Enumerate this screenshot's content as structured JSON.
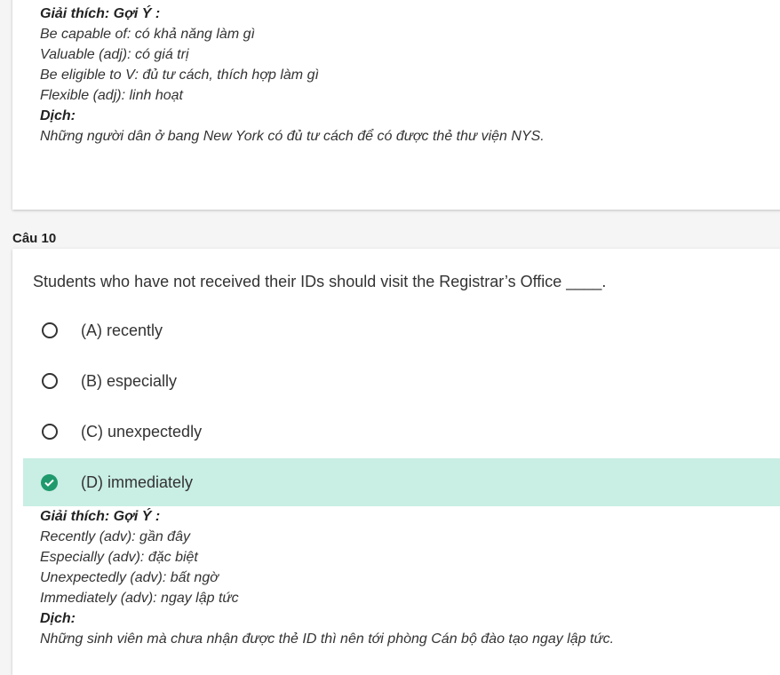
{
  "prev_explanation": {
    "heading": "Giải thích: Gợi Ý :",
    "lines": [
      "Be capable of: có khả năng làm gì",
      "Valuable (adj): có giá trị",
      "Be eligible to V: đủ tư cách, thích hợp làm gì",
      "Flexible (adj): linh hoạt"
    ],
    "translation_heading": "Dịch:",
    "translation": "Những người dân ở bang New York có đủ tư cách để có được thẻ thư viện NYS."
  },
  "question": {
    "label": "Câu 10",
    "text": "Students who have not received their IDs should visit the Registrar’s Office ____.",
    "options": [
      {
        "label": "(A) recently",
        "selected": false
      },
      {
        "label": "(B) especially",
        "selected": false
      },
      {
        "label": "(C) unexpectedly",
        "selected": false
      },
      {
        "label": "(D) immediately",
        "selected": true
      }
    ],
    "explanation": {
      "heading": "Giải thích: Gợi Ý :",
      "lines": [
        "Recently (adv): gần đây",
        "Especially (adv): đặc biệt",
        "Unexpectedly (adv): bất ngờ",
        "Immediately (adv): ngay lập tức"
      ],
      "translation_heading": "Dịch:",
      "translation": "Những sinh viên mà chưa nhận được thẻ ID thì nên tới phòng Cán bộ đào tạo ngay lập tức."
    }
  },
  "colors": {
    "correct_bg": "#c9eee4",
    "check_green": "#1e9a6c"
  }
}
